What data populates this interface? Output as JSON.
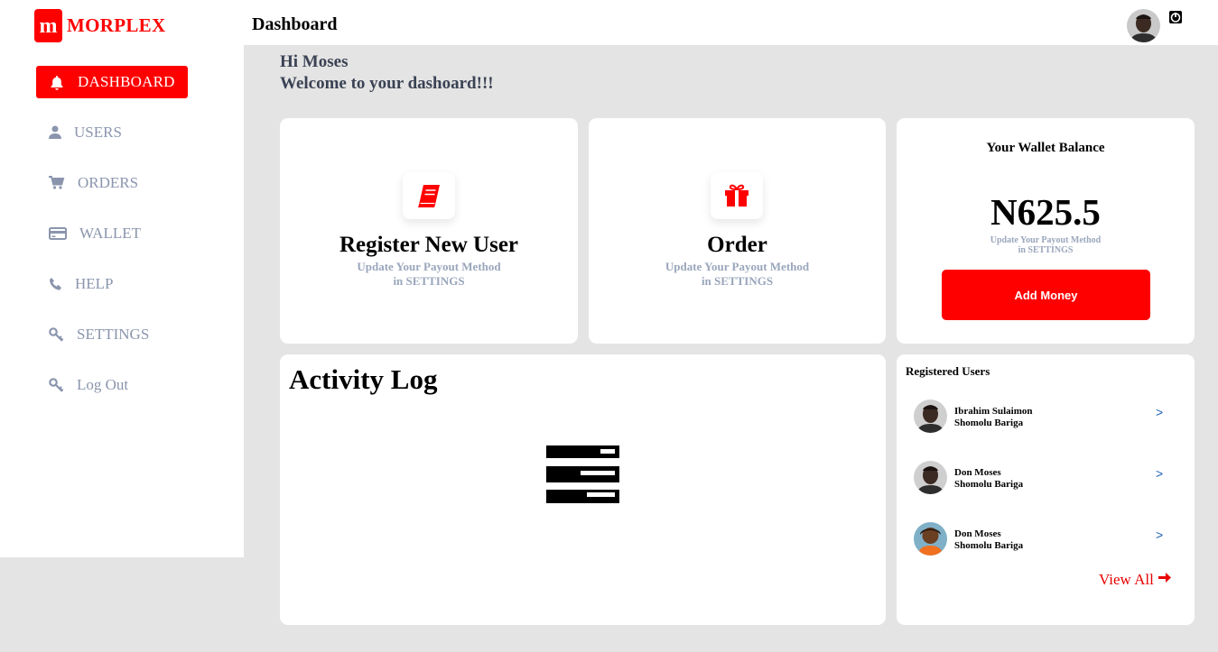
{
  "brand": {
    "logo_letter": "m",
    "name": "MORPLEX",
    "color": "#ff0000"
  },
  "sidebar": {
    "items": [
      {
        "label": "DASHBOARD",
        "icon": "bell-icon",
        "active": true
      },
      {
        "label": "USERS",
        "icon": "user-icon"
      },
      {
        "label": "ORDERS",
        "icon": "cart-icon"
      },
      {
        "label": "WALLET",
        "icon": "credit-card-icon"
      },
      {
        "label": "HELP",
        "icon": "phone-icon"
      },
      {
        "label": "SETTINGS",
        "icon": "key-icon"
      },
      {
        "label": "Log Out",
        "icon": "key-icon"
      }
    ]
  },
  "header": {
    "title": "Dashboard",
    "avatar_icon": "avatar",
    "action_icon": "logout-circle-icon"
  },
  "greeting": {
    "line1": "Hi Moses",
    "line2": "Welcome to your dashoard!!!"
  },
  "cards": {
    "register": {
      "icon": "book-icon",
      "title": "Register New User",
      "sub1": "Update Your Payout Method",
      "sub2": "in SETTINGS"
    },
    "order": {
      "icon": "gift-icon",
      "title": "Order",
      "sub1": "Update Your Payout Method",
      "sub2": "in SETTINGS"
    },
    "wallet": {
      "title": "Your Wallet Balance",
      "amount": "N625.5",
      "sub1": "Update Your Payout Method",
      "sub2": "in SETTINGS",
      "button": "Add Money"
    }
  },
  "activity": {
    "title": "Activity Log",
    "icon": "loader-icon"
  },
  "registered": {
    "title": "Registered Users",
    "users": [
      {
        "name": "Ibrahim Sulaimon",
        "location": "Shomolu Bariga",
        "arrow": ">"
      },
      {
        "name": "Don Moses",
        "location": "Shomolu Bariga",
        "arrow": ">"
      },
      {
        "name": "Don Moses",
        "location": "Shomolu Bariga",
        "arrow": ">"
      }
    ],
    "view_all": "View All"
  }
}
